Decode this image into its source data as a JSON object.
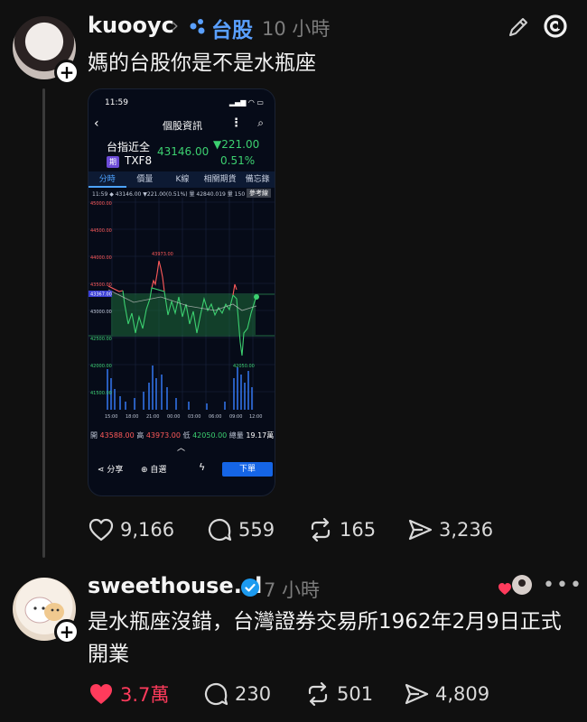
{
  "post1": {
    "username": "kuooyc",
    "topic": "台股",
    "time": "10 小時",
    "text": "媽的台股你是不是水瓶座",
    "stats": {
      "likes": "9,166",
      "replies": "559",
      "reposts": "165",
      "shares": "3,236"
    }
  },
  "phone": {
    "status_time": "11:59",
    "title": "個股資訊",
    "name": "台指近全",
    "price": "43146.00",
    "change": "▼221.00",
    "percent": "0.51%",
    "badge": "期",
    "code": "TXF8",
    "tabs": [
      "分時",
      "價量",
      "K線",
      "相關期貨",
      "備忘錄"
    ],
    "info_line": "11:59 ◆ 43146.00 ▼221.00(0.51%) 量 42840.019 量 150",
    "ref_label": "參考線",
    "ohlc": {
      "open_label": "開",
      "open": "43588.00",
      "high_label": "高",
      "high": "43973.00",
      "low_label": "低",
      "low": "42050.00",
      "vol_label": "總量",
      "vol": "19.17萬"
    },
    "share": "分享",
    "watch": "自選",
    "order": "下單",
    "colors": {
      "up": "#ff5a5a",
      "down": "#3cd070",
      "accent": "#4da3ff"
    }
  },
  "chart_data": {
    "type": "line",
    "y_ticks": [
      "43500.00",
      "43367.00",
      "43000.00",
      "42500.00",
      "42000.00",
      "41500.00"
    ],
    "y_ticks_upper": [
      "45000.00",
      "44500.00",
      "44000.00"
    ],
    "x_ticks": [
      "15:00",
      "18:00",
      "21:00",
      "00:00",
      "03:00",
      "06:00",
      "09:00",
      "12:00"
    ],
    "annotations": [
      "43973.00",
      "42050.00"
    ],
    "reference": 43367
  },
  "post2": {
    "username": "sweethouse.sl",
    "time": "7 小時",
    "text": "是水瓶座沒錯，台灣證券交易所1962年2月9日正式開業",
    "stats": {
      "likes": "3.7萬",
      "replies": "230",
      "reposts": "501",
      "shares": "4,809"
    }
  }
}
